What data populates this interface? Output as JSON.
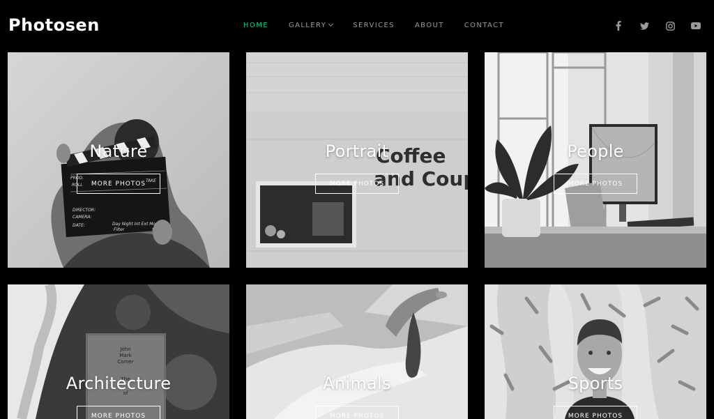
{
  "site": {
    "logo": "Photosen"
  },
  "nav": {
    "items": [
      {
        "label": "HOME",
        "active": true
      },
      {
        "label": "GALLERY",
        "dropdown": true
      },
      {
        "label": "SERVICES"
      },
      {
        "label": "ABOUT"
      },
      {
        "label": "CONTACT"
      }
    ]
  },
  "social": [
    "facebook-icon",
    "twitter-icon",
    "instagram-icon",
    "youtube-icon"
  ],
  "colors": {
    "accent": "#1fc28a",
    "nav_text": "#9a9a9a",
    "background": "#000000"
  },
  "gallery": {
    "tiles": [
      {
        "title": "Nature",
        "button": "MORE PHOTOS",
        "clapper": {
          "prod": "PROD.",
          "roll": "ROLL",
          "take": "TAKE",
          "director": "DIRECTOR:",
          "camera": "CAMERA:",
          "date": "DATE:",
          "daynight": "Day Night Int Ext Mos",
          "filter": "Filter",
          "sync": "Syn"
        }
      },
      {
        "title": "Portrait",
        "button": "MORE PHOTOS",
        "sign_line1": "Coffee",
        "sign_line2": "and Coup"
      },
      {
        "title": "People",
        "button": "MORE PHOTOS"
      },
      {
        "title": "Architecture",
        "button": "MORE PHOTOS",
        "book": {
          "author1": "John",
          "author2": "Mark",
          "author3": "Comer",
          "title1": "The",
          "title2": "of"
        }
      },
      {
        "title": "Animals",
        "button": "MORE PHOTOS"
      },
      {
        "title": "Sports",
        "button": "MORE PHOTOS"
      }
    ]
  }
}
